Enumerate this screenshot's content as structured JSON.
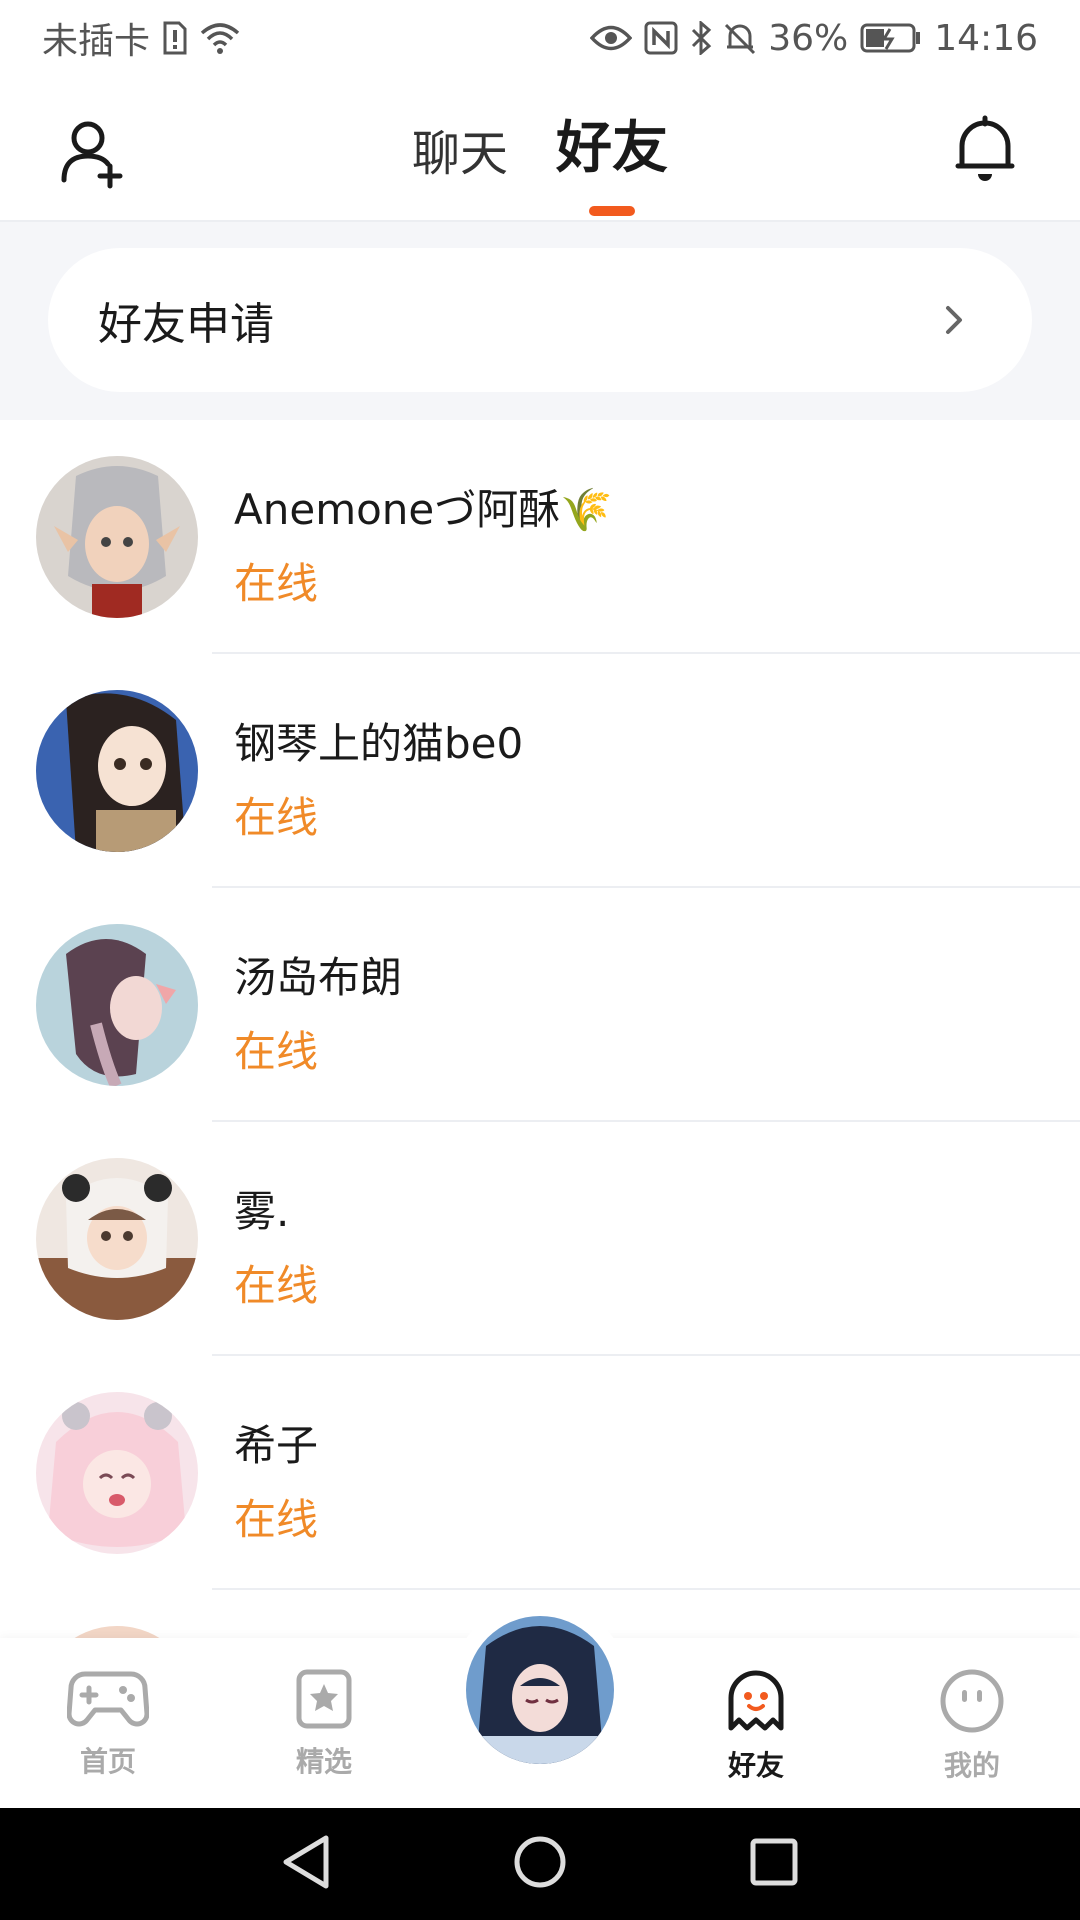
{
  "status_bar": {
    "carrier": "未插卡",
    "battery": "36%",
    "time": "14:16"
  },
  "header": {
    "tabs": [
      {
        "label": "聊天",
        "active": false
      },
      {
        "label": "好友",
        "active": true
      }
    ]
  },
  "friend_request": {
    "label": "好友申请"
  },
  "friends": [
    {
      "name": "Anemoneづ阿酥🌾",
      "status": "在线"
    },
    {
      "name": "钢琴上的猫be0",
      "status": "在线"
    },
    {
      "name": "汤岛布朗",
      "status": "在线"
    },
    {
      "name": "雾.",
      "status": "在线"
    },
    {
      "name": "希子",
      "status": "在线"
    }
  ],
  "bottom_nav": {
    "items": [
      {
        "label": "首页",
        "icon": "gamepad-icon",
        "active": false
      },
      {
        "label": "精选",
        "icon": "star-bookmark-icon",
        "active": false
      },
      {
        "label": "好友",
        "icon": "ghost-icon",
        "active": true
      },
      {
        "label": "我的",
        "icon": "face-icon",
        "active": false
      }
    ]
  },
  "colors": {
    "accent": "#f25a1e",
    "online": "#f08a28",
    "background_gray": "#f5f6f9"
  }
}
